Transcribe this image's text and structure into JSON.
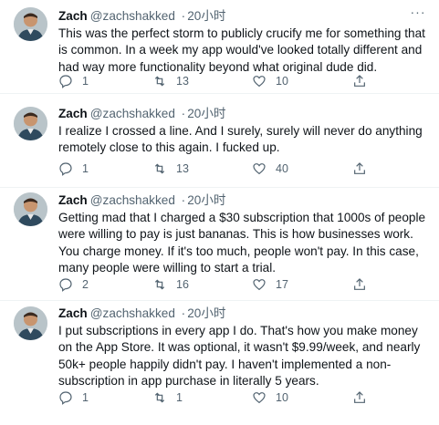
{
  "tweets": [
    {
      "name": "Zach",
      "handle": "@zachshakked",
      "separator": "·",
      "time": "20小时",
      "text": "This was the perfect storm to publicly crucify me for something that is common. In a week my app would've looked totally different and had way more functionality beyond what original dude did.",
      "replies": "1",
      "retweets": "13",
      "likes": "10"
    },
    {
      "name": "Zach",
      "handle": "@zachshakked",
      "separator": "·",
      "time": "20小时",
      "text": "I realize I crossed a line. And I surely, surely will never do anything remotely close to this again. I fucked up.",
      "replies": "1",
      "retweets": "13",
      "likes": "40"
    },
    {
      "name": "Zach",
      "handle": "@zachshakked",
      "separator": "·",
      "time": "20小时",
      "text": "Getting mad that I charged a $30 subscription that 1000s of people were willing to pay is just bananas. This is how businesses work. You charge money. If it's too much, people won't pay. In this case, many people were willing to start a trial.",
      "replies": "2",
      "retweets": "16",
      "likes": "17"
    },
    {
      "name": "Zach",
      "handle": "@zachshakked",
      "separator": "·",
      "time": "20小时",
      "text": "I put subscriptions in every app I do. That's how you make money on the App Store. It was optional, it wasn't $9.99/week, and nearly 50k+ people happily didn't pay. I haven't implemented a non-subscription in app purchase in literally 5 years.",
      "replies": "1",
      "retweets": "1",
      "likes": "10"
    }
  ],
  "icons": {
    "reply": "reply-icon",
    "retweet": "retweet-icon",
    "like": "heart-icon",
    "share": "share-icon",
    "more": "more-icon"
  },
  "colors": {
    "text": "#0f1419",
    "secondary": "#536471",
    "divider": "#eff3f4"
  }
}
